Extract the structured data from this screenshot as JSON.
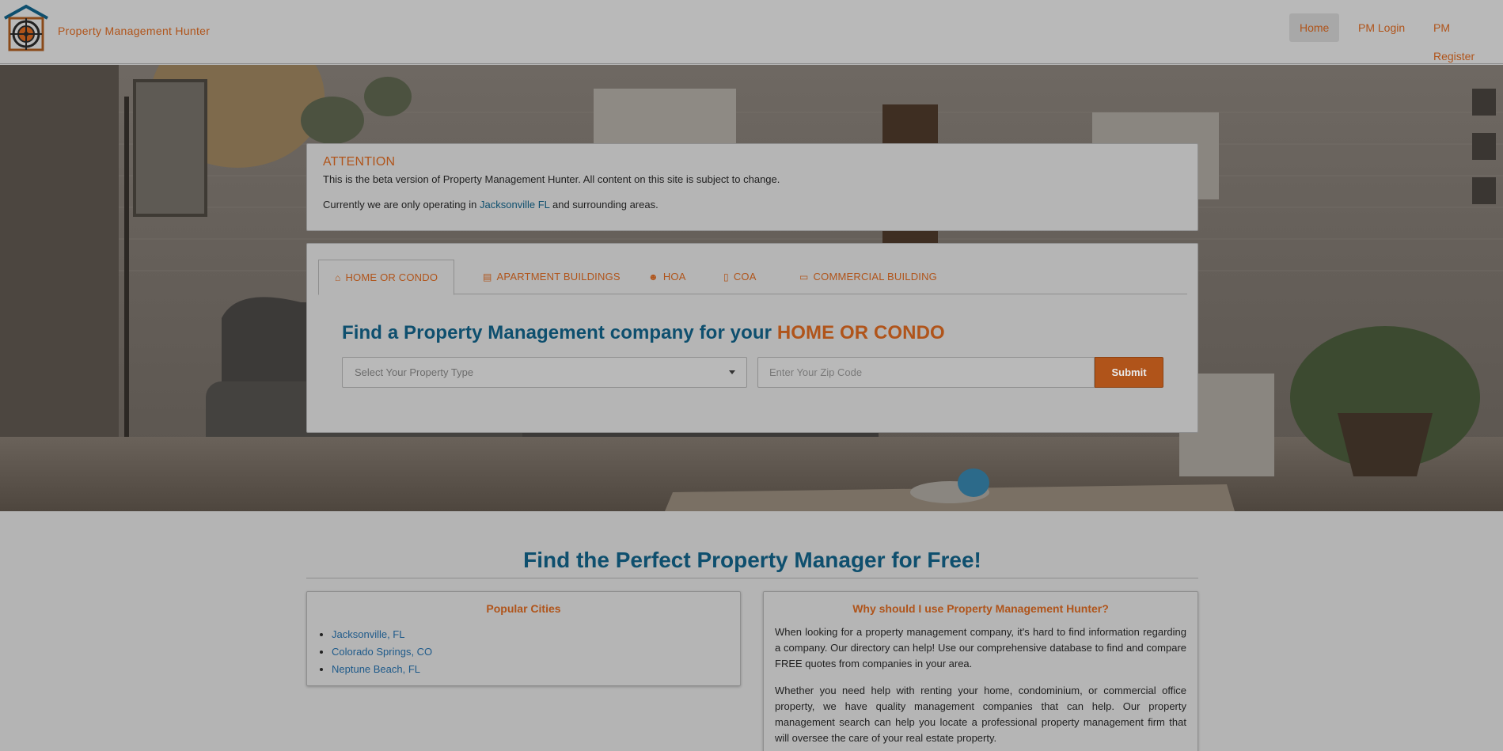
{
  "header": {
    "brand": "Property Management Hunter",
    "nav": [
      {
        "label": "Home",
        "active": true
      },
      {
        "label": "PM Login",
        "active": false
      },
      {
        "label": "PM Register",
        "active": false
      }
    ]
  },
  "attention": {
    "title": "ATTENTION",
    "line1": "This is the beta version of Property Management Hunter. All content on this site is subject to change.",
    "line2_prefix": "Currently we are only operating in ",
    "line2_link": "Jacksonville FL",
    "line2_suffix": " and surrounding areas."
  },
  "search": {
    "tabs": [
      {
        "label": "HOME OR CONDO",
        "icon": "home-icon",
        "active": true
      },
      {
        "label": "APARTMENT BUILDINGS",
        "icon": "building-icon",
        "active": false
      },
      {
        "label": "HOA",
        "icon": "users-icon",
        "active": false
      },
      {
        "label": "COA",
        "icon": "building-icon",
        "active": false
      },
      {
        "label": "COMMERCIAL BUILDING",
        "icon": "briefcase-icon",
        "active": false
      }
    ],
    "heading_prefix": "Find a Property Management company for your ",
    "heading_highlight": "HOME OR CONDO",
    "select_placeholder": "Select Your Property Type",
    "zip_placeholder": "Enter Your Zip Code",
    "submit_label": "Submit"
  },
  "main": {
    "heading": "Find the Perfect Property Manager for Free!",
    "popular": {
      "title": "Popular Cities",
      "cities": [
        "Jacksonville, FL",
        "Colorado Springs, CO",
        "Neptune Beach, FL"
      ]
    },
    "why": {
      "title": "Why should I use Property Management Hunter?",
      "p1": "When looking for a property management company, it's hard to find information regarding a company. Our directory can help! Use our comprehensive database to find and compare FREE quotes from companies in your area.",
      "p2": "Whether you need help with renting your home, condominium, or commercial office property, we have quality management companies that can help. Our property management search can help you locate a professional property management firm that will oversee the care of your real estate property."
    }
  },
  "colors": {
    "accent": "#b0541a",
    "primary": "#0e4f6e",
    "link": "#1e5a8a"
  }
}
